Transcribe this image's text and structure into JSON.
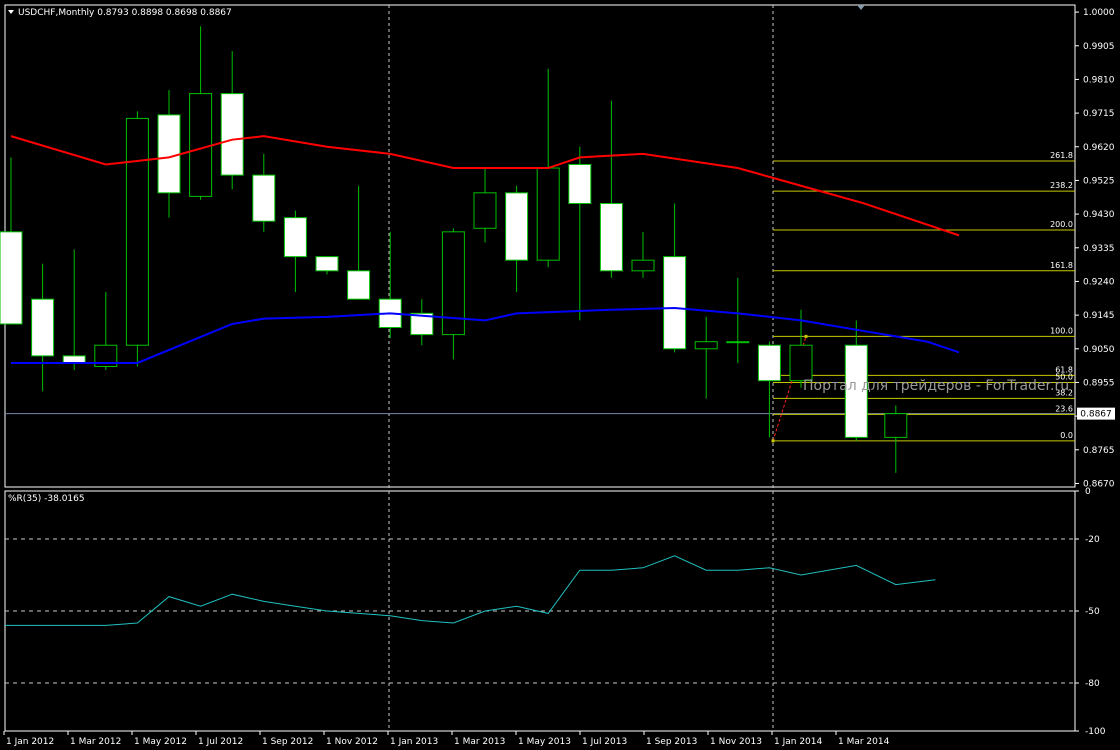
{
  "window": {
    "symbol_header": "USDCHF,Monthly  0.8793 0.8898 0.8698 0.8867",
    "indicator_header": "%R(35) -38.0165",
    "watermark": "Портал для трейдеров - ForTrader.ru"
  },
  "colors": {
    "background": "#000000",
    "frame": "#ffffff",
    "grid": "#c8c8c8",
    "bull_candle": "#000000",
    "bear_candle": "#ffffff",
    "candle_outline": "#00c000",
    "ma_slow": "#ff0000",
    "ma_fast": "#0000ff",
    "fib_levels": "#c8c800",
    "percent_r": "#20c0c0",
    "bid_line": "#7788aa",
    "trend_dashed": "#ff2020"
  },
  "chart_data": [
    {
      "type": "candlestick",
      "title": "USDCHF,Monthly",
      "price_axis_ticks": [
        "1.0000",
        "0.9905",
        "0.9810",
        "0.9715",
        "0.9620",
        "0.9525",
        "0.9430",
        "0.9335",
        "0.9240",
        "0.9145",
        "0.9050",
        "0.8955",
        "0.8860",
        "0.8765",
        "0.8670"
      ],
      "ylim": [
        0.866,
        1.002
      ],
      "current_price": "0.8867",
      "time_axis_labels": [
        "1 Jan 2012",
        "1 Mar 2012",
        "1 May 2012",
        "1 Jul 2012",
        "1 Sep 2012",
        "1 Nov 2012",
        "1 Jan 2013",
        "1 Mar 2013",
        "1 May 2013",
        "1 Jul 2013",
        "1 Sep 2013",
        "1 Nov 2013",
        "1 Jan 2014",
        "1 Mar 2014"
      ],
      "candles": [
        {
          "t": "2011-10",
          "o": 0.938,
          "h": 0.959,
          "l": 0.912,
          "c": 0.912
        },
        {
          "t": "2011-11",
          "o": 0.919,
          "h": 0.929,
          "l": 0.893,
          "c": 0.903
        },
        {
          "t": "2011-12",
          "o": 0.903,
          "h": 0.933,
          "l": 0.899,
          "c": 0.901
        },
        {
          "t": "2012-01",
          "o": 0.9,
          "h": 0.921,
          "l": 0.899,
          "c": 0.906
        },
        {
          "t": "2012-02",
          "o": 0.906,
          "h": 0.972,
          "l": 0.9,
          "c": 0.97
        },
        {
          "t": "2012-03",
          "o": 0.971,
          "h": 0.978,
          "l": 0.942,
          "c": 0.949
        },
        {
          "t": "2012-04",
          "o": 0.948,
          "h": 0.996,
          "l": 0.947,
          "c": 0.977
        },
        {
          "t": "2012-05",
          "o": 0.977,
          "h": 0.989,
          "l": 0.95,
          "c": 0.954
        },
        {
          "t": "2012-06",
          "o": 0.954,
          "h": 0.96,
          "l": 0.938,
          "c": 0.941
        },
        {
          "t": "2012-07",
          "o": 0.942,
          "h": 0.944,
          "l": 0.921,
          "c": 0.931
        },
        {
          "t": "2012-08",
          "o": 0.931,
          "h": 0.931,
          "l": 0.926,
          "c": 0.927
        },
        {
          "t": "2012-09",
          "o": 0.927,
          "h": 0.951,
          "l": 0.919,
          "c": 0.919
        },
        {
          "t": "2012-10",
          "o": 0.919,
          "h": 0.938,
          "l": 0.908,
          "c": 0.911
        },
        {
          "t": "2012-11",
          "o": 0.915,
          "h": 0.919,
          "l": 0.906,
          "c": 0.909
        },
        {
          "t": "2012-12",
          "o": 0.909,
          "h": 0.939,
          "l": 0.902,
          "c": 0.938
        },
        {
          "t": "2013-01",
          "o": 0.939,
          "h": 0.956,
          "l": 0.935,
          "c": 0.949
        },
        {
          "t": "2013-02",
          "o": 0.949,
          "h": 0.951,
          "l": 0.921,
          "c": 0.93
        },
        {
          "t": "2013-03",
          "o": 0.93,
          "h": 0.984,
          "l": 0.928,
          "c": 0.956
        },
        {
          "t": "2013-04",
          "o": 0.957,
          "h": 0.962,
          "l": 0.913,
          "c": 0.946
        },
        {
          "t": "2013-05",
          "o": 0.946,
          "h": 0.975,
          "l": 0.925,
          "c": 0.927
        },
        {
          "t": "2013-06",
          "o": 0.927,
          "h": 0.938,
          "l": 0.925,
          "c": 0.93
        },
        {
          "t": "2013-07",
          "o": 0.931,
          "h": 0.946,
          "l": 0.904,
          "c": 0.905
        },
        {
          "t": "2013-08",
          "o": 0.905,
          "h": 0.914,
          "l": 0.891,
          "c": 0.907
        },
        {
          "t": "2013-09",
          "o": 0.907,
          "h": 0.925,
          "l": 0.901,
          "c": 0.907
        },
        {
          "t": "2013-10",
          "o": 0.906,
          "h": 0.907,
          "l": 0.88,
          "c": 0.896
        },
        {
          "t": "2013-11",
          "o": 0.896,
          "h": 0.916,
          "l": 0.894,
          "c": 0.906
        },
        {
          "t": "2014-01",
          "o": 0.906,
          "h": 0.913,
          "l": 0.879,
          "c": 0.88
        },
        {
          "t": "2014-02",
          "o": 0.88,
          "h": 0.889,
          "l": 0.87,
          "c": 0.8867
        }
      ],
      "ma_slow_points": [
        [
          0,
          0.965
        ],
        [
          3,
          0.957
        ],
        [
          5,
          0.959
        ],
        [
          7,
          0.964
        ],
        [
          8,
          0.965
        ],
        [
          10,
          0.962
        ],
        [
          12,
          0.96
        ],
        [
          14,
          0.956
        ],
        [
          17,
          0.956
        ],
        [
          18,
          0.959
        ],
        [
          20,
          0.96
        ],
        [
          23,
          0.956
        ],
        [
          25,
          0.951
        ],
        [
          27,
          0.946
        ],
        [
          29,
          0.94
        ],
        [
          30,
          0.937
        ]
      ],
      "ma_fast_points": [
        [
          0,
          0.901
        ],
        [
          4,
          0.901
        ],
        [
          7,
          0.912
        ],
        [
          8,
          0.9135
        ],
        [
          10,
          0.914
        ],
        [
          12,
          0.915
        ],
        [
          15,
          0.913
        ],
        [
          16,
          0.915
        ],
        [
          19,
          0.916
        ],
        [
          21,
          0.9165
        ],
        [
          23,
          0.915
        ],
        [
          25,
          0.913
        ],
        [
          27,
          0.91
        ],
        [
          29,
          0.907
        ],
        [
          30,
          0.904
        ]
      ],
      "fibonacci": {
        "levels": [
          {
            "label": "261.8",
            "price": 0.958
          },
          {
            "label": "238.2",
            "price": 0.9495
          },
          {
            "label": "200.0",
            "price": 0.9385
          },
          {
            "label": "161.8",
            "price": 0.927
          },
          {
            "label": "100.0",
            "price": 0.9085
          },
          {
            "label": "61.8",
            "price": 0.8975
          },
          {
            "label": "50.0",
            "price": 0.8955
          },
          {
            "label": "38.2",
            "price": 0.891
          },
          {
            "label": "23.6",
            "price": 0.8865
          },
          {
            "label": "0.0",
            "price": 0.879
          }
        ]
      }
    },
    {
      "type": "line",
      "title": "%R(35) -38.0165",
      "series": [
        {
          "name": "%R(35)",
          "values": [
            -56,
            -56,
            -56,
            -56,
            -55,
            -44,
            -48,
            -43,
            -46,
            -48,
            -50,
            -51,
            -52,
            -54,
            -55,
            -50,
            -48,
            -51,
            -33,
            -33,
            -32,
            -27,
            -33,
            -33,
            -32,
            -35,
            -31,
            -39,
            -37
          ]
        }
      ],
      "axis_ticks": [
        "0",
        "-20",
        "-50",
        "-80",
        "-100"
      ],
      "ylim": [
        -100,
        0
      ],
      "grid": true
    }
  ]
}
